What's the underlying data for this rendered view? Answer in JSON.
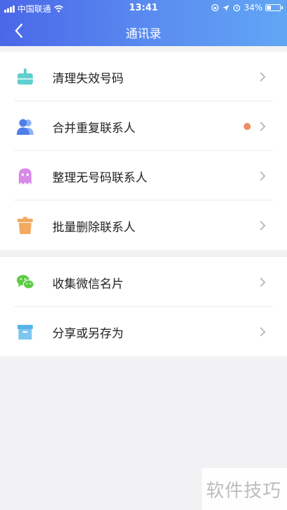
{
  "status_bar": {
    "carrier": "中国联通",
    "time": "13:41",
    "battery_text": "34%",
    "battery_level": 0.34
  },
  "nav": {
    "title": "通讯录",
    "back_icon": "chevron-left-icon"
  },
  "colors": {
    "header_gradient_start": "#4a67e8",
    "header_gradient_end": "#61a6f5",
    "badge": "#ef8a62"
  },
  "section1": {
    "items": [
      {
        "label": "清理失效号码",
        "icon": "broom-icon",
        "icon_color": "#5fcfcf"
      },
      {
        "label": "合并重复联系人",
        "icon": "contacts-icon",
        "icon_color": "#4f7ee9",
        "badge": true
      },
      {
        "label": "整理无号码联系人",
        "icon": "ghost-icon",
        "icon_color": "#d78ae8"
      },
      {
        "label": "批量删除联系人",
        "icon": "trash-icon",
        "icon_color": "#f3a960"
      }
    ]
  },
  "section2": {
    "items": [
      {
        "label": "收集微信名片",
        "icon": "wechat-icon",
        "icon_color": "#5ccc45"
      },
      {
        "label": "分享或另存为",
        "icon": "archive-box-icon",
        "icon_color": "#58b4e8"
      }
    ]
  },
  "watermark": {
    "text": "软件技巧"
  }
}
